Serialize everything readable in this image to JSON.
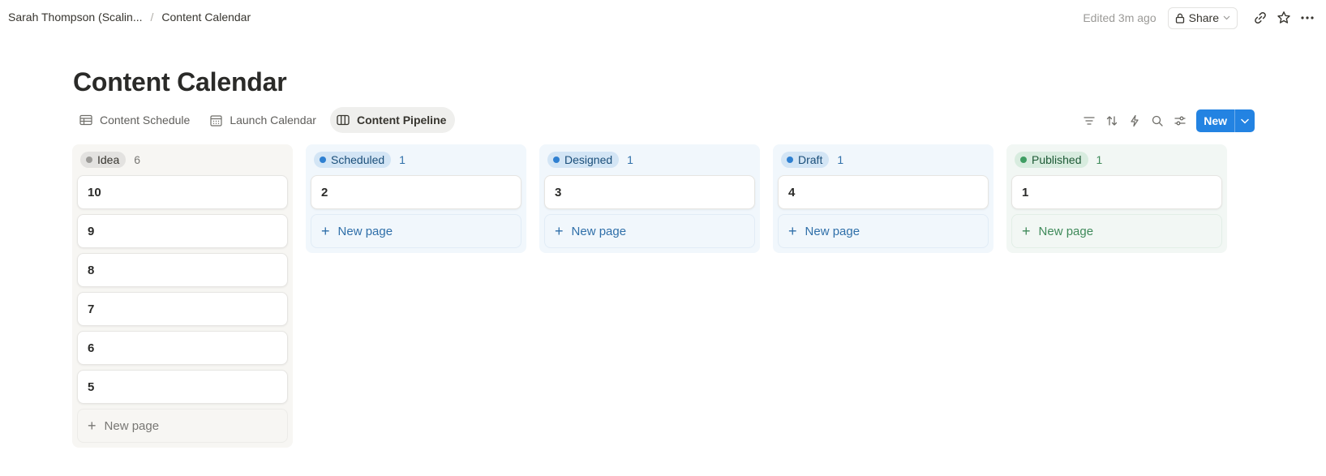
{
  "breadcrumb": {
    "workspace": "Sarah Thompson (Scalin...",
    "separator": "/",
    "page": "Content Calendar"
  },
  "header": {
    "edited": "Edited 3m ago",
    "share_label": "Share"
  },
  "page": {
    "title": "Content Calendar"
  },
  "views": [
    {
      "label": "Content Schedule",
      "icon": "table-icon"
    },
    {
      "label": "Launch Calendar",
      "icon": "calendar-icon"
    },
    {
      "label": "Content Pipeline",
      "icon": "board-icon",
      "active": true
    }
  ],
  "toolbar": {
    "icons": [
      "filter-icon",
      "sort-icon",
      "automation-icon",
      "search-icon",
      "settings-icon"
    ],
    "new_label": "New"
  },
  "board": {
    "new_page_label": "New page",
    "columns": [
      {
        "status": "Idea",
        "count": "6",
        "color": "gray",
        "cards": [
          "10",
          "9",
          "8",
          "7",
          "6",
          "5"
        ]
      },
      {
        "status": "Scheduled",
        "count": "1",
        "color": "blue",
        "cards": [
          "2"
        ]
      },
      {
        "status": "Designed",
        "count": "1",
        "color": "blue",
        "cards": [
          "3"
        ]
      },
      {
        "status": "Draft",
        "count": "1",
        "color": "blue",
        "cards": [
          "4"
        ]
      },
      {
        "status": "Published",
        "count": "1",
        "color": "green",
        "cards": [
          "1"
        ]
      }
    ]
  },
  "colors": {
    "accent": "#2383e2",
    "gray_column": "#f7f6f3",
    "blue_column": "#f1f7fc",
    "green_column": "#f2f7f4"
  }
}
